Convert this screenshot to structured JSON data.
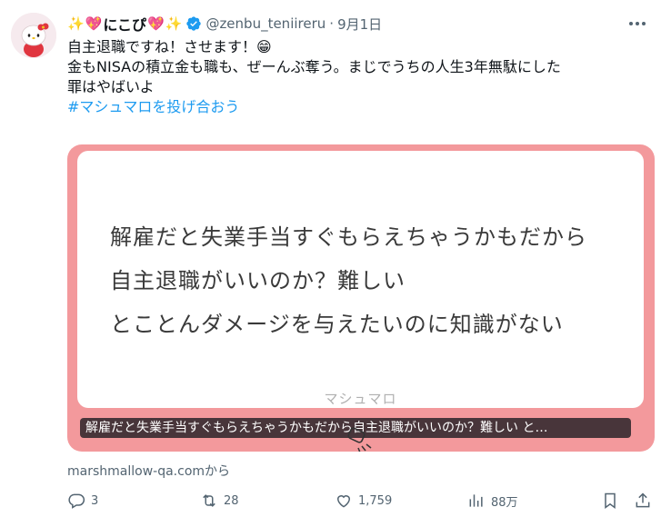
{
  "tweet": {
    "display_name": "にこぴ",
    "name_emojis_left": [
      "✨",
      "💖"
    ],
    "name_emojis_right": [
      "💖",
      "✨"
    ],
    "handle": "@zenbu_teniireru",
    "separator": "·",
    "date": "9月1日",
    "text_lines": [
      "自主退職ですね！させます！😁",
      "金もNISAの積立金も職も、ぜーんぶ奪う。まじでうちの人生3年無駄にした",
      "罪はやばいよ"
    ],
    "hashtag": "#マシュマロを投げ合おう",
    "avatar_icon": "hello-kitty-avatar",
    "verified_icon": "verified-badge-icon",
    "more_icon": "more-icon"
  },
  "card": {
    "lines": [
      "解雇だと失業手当すぐもらえちゃうかもだから",
      "自主退職がいいのか？難しい",
      "とことんダメージを与えたいのに知識がない"
    ],
    "brand": "マシュマロ",
    "caption": "解雇だと失業手当すぐもらえちゃうかもだから自主退職がいいのか？難しい と…",
    "border_color": "#f3999c"
  },
  "source": "marshmallow-qa.comから",
  "actions": {
    "reply": "3",
    "retweet": "28",
    "like": "1,759",
    "views": "88万"
  },
  "colors": {
    "text": "#0f1419",
    "muted": "#536471",
    "link": "#1d9bf0",
    "verified": "#1d9bf0"
  }
}
